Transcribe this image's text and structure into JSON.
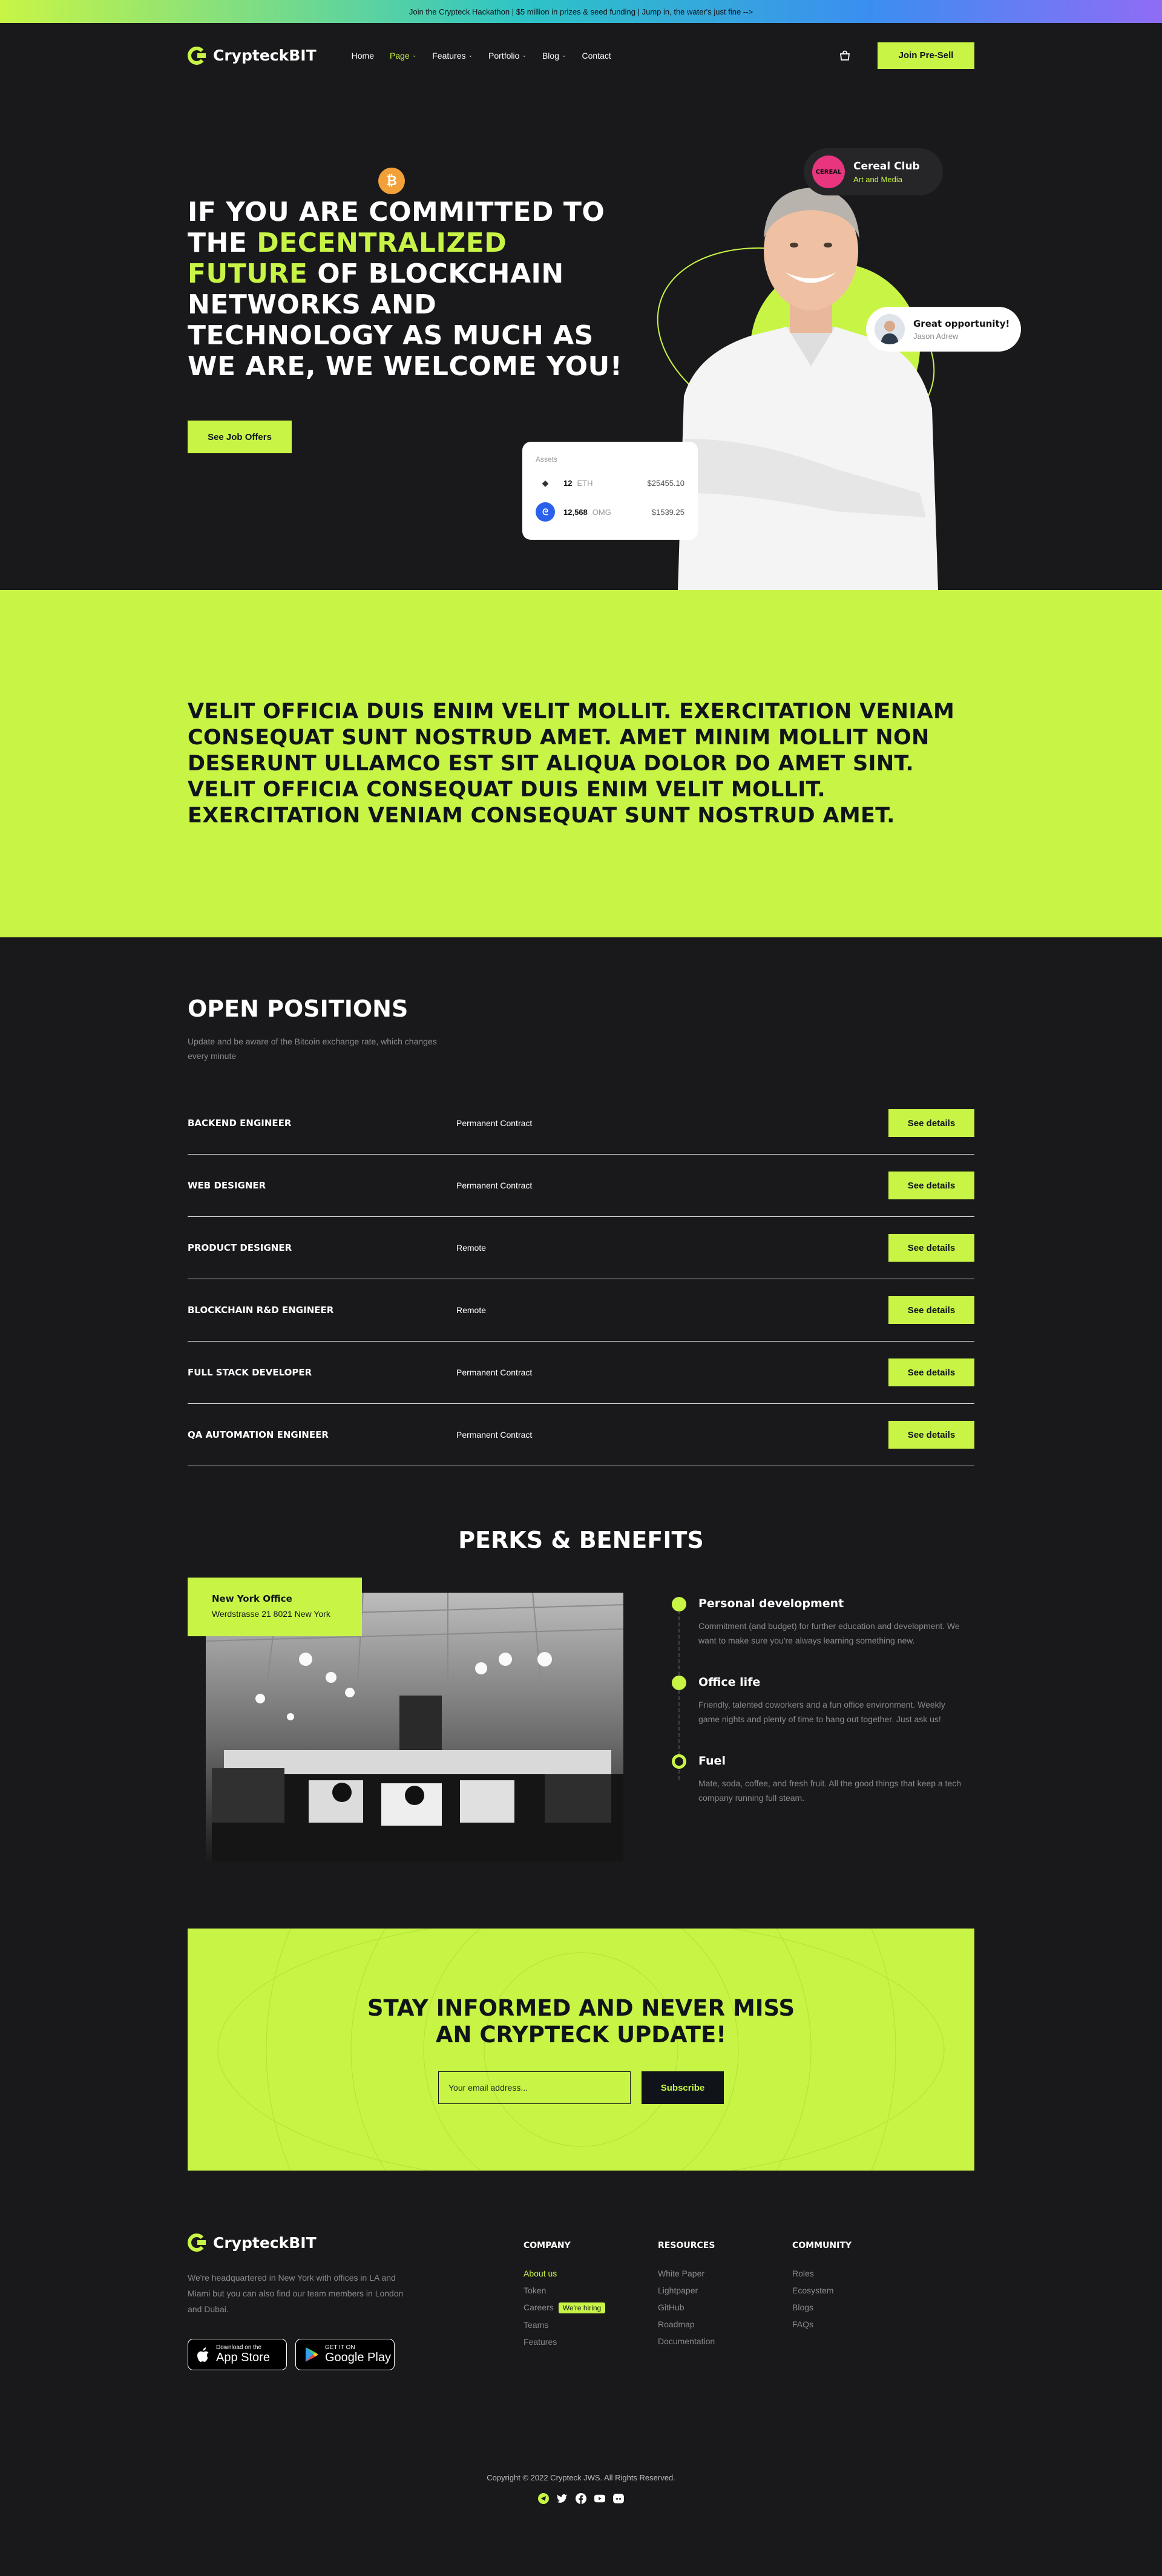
{
  "announcement": "Join the Crypteck Hackathon | $5 million in prizes & seed funding | Jump in, the water's just fine -->",
  "brand": {
    "name": "CrypteckBIT"
  },
  "nav": {
    "items": [
      {
        "label": "Home",
        "dropdown": false,
        "active": false
      },
      {
        "label": "Page",
        "dropdown": true,
        "active": true
      },
      {
        "label": "Features",
        "dropdown": true,
        "active": false
      },
      {
        "label": "Portfolio",
        "dropdown": true,
        "active": false
      },
      {
        "label": "Blog",
        "dropdown": true,
        "active": false
      },
      {
        "label": "Contact",
        "dropdown": false,
        "active": false
      }
    ],
    "cart_icon": "shopping-bag-icon",
    "presale_label": "Join Pre-Sell"
  },
  "hero": {
    "heading_line1": "IF YOU ARE COMMITTED TO THE ",
    "heading_highlight": "DECENTRALIZED FUTURE",
    "heading_line2": " OF BLOCKCHAIN NETWORKS AND TECHNOLOGY AS MUCH AS WE ARE, WE WELCOME YOU!",
    "cta_label": "See Job Offers",
    "btc_symbol": "₿",
    "club_card": {
      "avatar_text": "CEREAL",
      "title": "Cereal Club",
      "subtitle": "Art and Media"
    },
    "opportunity_card": {
      "title": "Great opportunity!",
      "name": "Jason Adrew"
    },
    "assets_card": {
      "title": "Assets",
      "rows": [
        {
          "icon": "ethereum-icon",
          "glyph": "◆",
          "amount": "12",
          "symbol": "ETH",
          "value": "$25455.10"
        },
        {
          "icon": "omg-icon",
          "glyph": "ᘓ",
          "amount": "12,568",
          "symbol": "OMG",
          "value": "$1539.25"
        }
      ]
    }
  },
  "statement": "Velit officia duis enim velit mollit. Exercitation veniam consequat sunt nostrud amet. Amet minim mollit non deserunt ullamco est sit aliqua dolor do amet sint. Velit officia consequat duis enim velit mollit. Exercitation veniam consequat sunt nostrud amet.",
  "positions": {
    "title": "Open Positions",
    "lead": "Update and be aware of the Bitcoin exchange rate, which changes every minute",
    "button_label": "See details",
    "rows": [
      {
        "title": "Backend Engineer",
        "type": "Permanent Contract"
      },
      {
        "title": "Web Designer",
        "type": "Permanent Contract"
      },
      {
        "title": "Product Designer",
        "type": "Remote"
      },
      {
        "title": "Blockchain R&D Engineer",
        "type": "Remote"
      },
      {
        "title": "Full Stack Developer",
        "type": "Permanent Contract"
      },
      {
        "title": "QA Automation Engineer",
        "type": "Permanent Contract"
      }
    ]
  },
  "perks": {
    "title": "Perks & Benefits",
    "office": {
      "title": "New York Office",
      "address": "Werdstrasse 21 8021 New York"
    },
    "items": [
      {
        "title": "Personal development",
        "text": "Commitment (and budget) for further education and development. We want to make sure you're always learning something new."
      },
      {
        "title": "Office life",
        "text": "Friendly, talented coworkers and a fun office environment. Weekly game nights and plenty of time to hang out together. Just ask us!"
      },
      {
        "title": "Fuel",
        "text": "Mate, soda, coffee, and fresh fruit. All the good things that keep a tech company running full steam."
      }
    ]
  },
  "subscribe": {
    "title": "Stay informed and never miss an Crypteck update!",
    "placeholder": "Your email address...",
    "button_label": "Subscribe"
  },
  "footer": {
    "about": "We're headquartered in New York with offices in LA and Miami but you can also find our team members in London and Dubai.",
    "app_store": {
      "small": "Download on the",
      "big": "App Store"
    },
    "google_play": {
      "small": "GET IT ON",
      "big": "Google Play"
    },
    "columns": [
      {
        "title": "Company",
        "links": [
          "About us",
          "Token",
          "Careers",
          "Teams",
          "Features"
        ],
        "active_index": 0,
        "badge_index": 2,
        "badge": "We're hiring"
      },
      {
        "title": "Resources",
        "links": [
          "White Paper",
          "Lightpaper",
          "GitHub",
          "Roadmap",
          "Documentation"
        ]
      },
      {
        "title": "Community",
        "links": [
          "Roles",
          "Ecosystem",
          "Blogs",
          "FAQs"
        ]
      }
    ],
    "copyright": "Copyright © 2022 Crypteck JWS. All Rights Reserved.",
    "socials": [
      "telegram-icon",
      "twitter-icon",
      "facebook-icon",
      "youtube-icon",
      "discord-icon"
    ]
  },
  "colors": {
    "accent": "#c8f545",
    "background": "#19191b",
    "dark": "#10141a"
  }
}
